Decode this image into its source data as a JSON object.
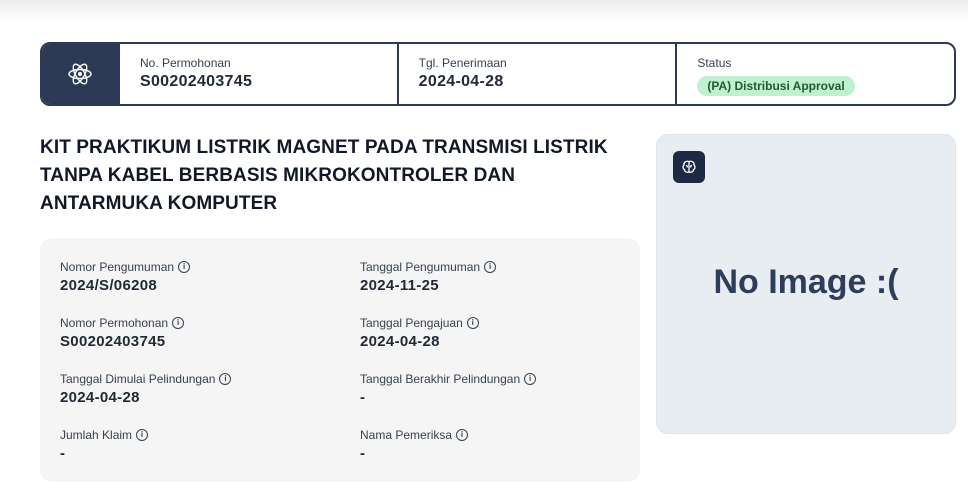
{
  "header": {
    "icon": "atom-icon",
    "application_number": {
      "label": "No. Permohonan",
      "value": "S00202403745"
    },
    "receipt_date": {
      "label": "Tgl. Penerimaan",
      "value": "2024-04-28"
    },
    "status": {
      "label": "Status",
      "value": "(PA) Distribusi Approval",
      "color": "#bff0cf"
    }
  },
  "title": "KIT PRAKTIKUM LISTRIK MAGNET PADA TRANSMISI LISTRIK TANPA KABEL BERBASIS MIKROKONTROLER DAN ANTARMUKA KOMPUTER",
  "details": [
    {
      "label": "Nomor Pengumuman",
      "value": "2024/S/06208"
    },
    {
      "label": "Tanggal Pengumuman",
      "value": "2024-11-25"
    },
    {
      "label": "Nomor Permohonan",
      "value": "S00202403745"
    },
    {
      "label": "Tanggal Pengajuan",
      "value": "2024-04-28"
    },
    {
      "label": "Tanggal Dimulai Pelindungan",
      "value": "2024-04-28"
    },
    {
      "label": "Tanggal Berakhir Pelindungan",
      "value": "-"
    },
    {
      "label": "Jumlah Klaim",
      "value": "-"
    },
    {
      "label": "Nama Pemeriksa",
      "value": "-"
    }
  ],
  "image_panel": {
    "icon": "brain-icon",
    "placeholder": "No Image :("
  }
}
